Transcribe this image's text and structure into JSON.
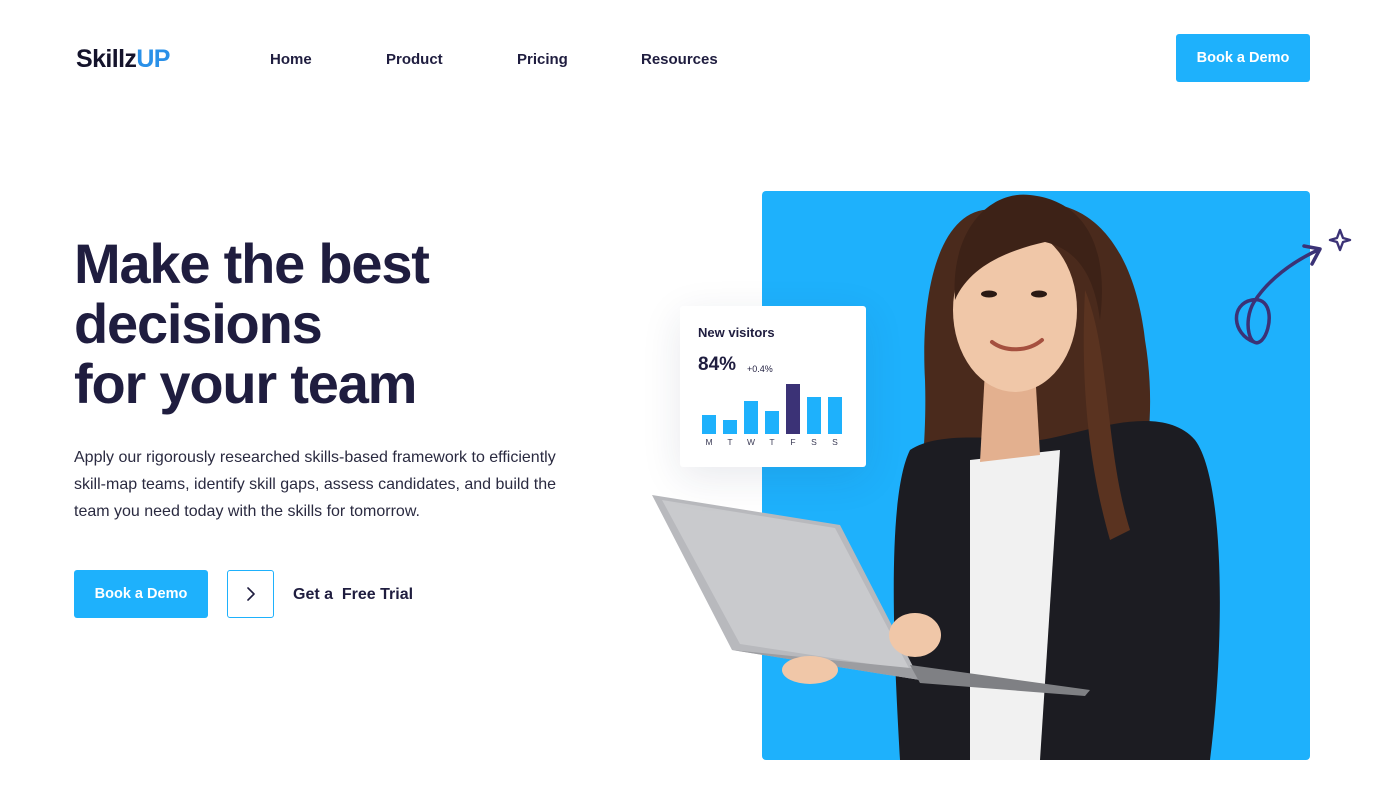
{
  "header": {
    "logo_main": "Skillz",
    "logo_accent": "UP",
    "nav": [
      "Home",
      "Product",
      "Pricing",
      "Resources"
    ],
    "cta_label": "Book a Demo"
  },
  "hero": {
    "title_lines": [
      "Make the best",
      "decisions",
      "for your team"
    ],
    "subtitle_lines": [
      "Apply our rigorously researched skills-based framework to efficiently",
      "skill-map teams, identify skill gaps, assess candidates, and build the",
      "team you need today with the skills for tomorrow."
    ],
    "primary_cta": "Book a Demo",
    "arrow_icon": "chevron-right-icon",
    "secondary_cta": "Get a  Free Trial"
  },
  "stats_card": {
    "title": "New visitors",
    "value": "84%",
    "delta": "+0.4%",
    "days": [
      "M",
      "T",
      "W",
      "T",
      "F",
      "S",
      "S"
    ],
    "levels": [
      0.38,
      0.27,
      0.65,
      0.46,
      1.0,
      0.74,
      0.74
    ],
    "highlight_index": 4
  },
  "colors": {
    "accent": "#1eb1fc",
    "logo_accent": "#2a90e8",
    "heading": "#1f1d3f",
    "highlight_bar": "#3b3276",
    "swirl": "#3b3276"
  },
  "icons": [
    "chevron-right-icon",
    "swirl-arrow-icon",
    "sparkle-icon"
  ]
}
